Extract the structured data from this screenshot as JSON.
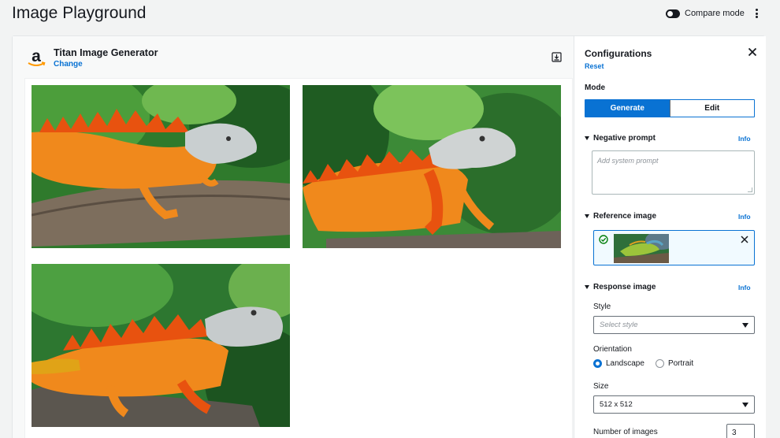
{
  "page": {
    "title": "Image Playground"
  },
  "header": {
    "compare_mode_label": "Compare mode",
    "compare_mode_on": true
  },
  "model": {
    "name": "Titan Image Generator",
    "change_label": "Change"
  },
  "gallery": {
    "images": [
      {
        "alt": "Orange iguana on a branch, image 1"
      },
      {
        "alt": "Orange iguana on a branch, image 2"
      },
      {
        "alt": "Orange iguana on a branch, image 3"
      }
    ]
  },
  "config": {
    "title": "Configurations",
    "reset_label": "Reset",
    "mode": {
      "label": "Mode",
      "options": [
        "Generate",
        "Edit"
      ],
      "selected": "Generate"
    },
    "negative_prompt": {
      "label": "Negative prompt",
      "info": "Info",
      "placeholder": "Add system prompt"
    },
    "reference_image": {
      "label": "Reference image",
      "info": "Info"
    },
    "response_image": {
      "label": "Response image",
      "info": "Info",
      "style": {
        "label": "Style",
        "placeholder": "Select style"
      },
      "orientation": {
        "label": "Orientation",
        "options": [
          "Landscape",
          "Portrait"
        ],
        "selected": "Landscape"
      },
      "size": {
        "label": "Size",
        "value": "512 x 512"
      },
      "num_images": {
        "label": "Number of images",
        "value": "3"
      }
    }
  },
  "colors": {
    "accent": "#0972d3",
    "text": "#16191f",
    "iguana": "#f0891c",
    "foliage": "#2f7a2c"
  }
}
